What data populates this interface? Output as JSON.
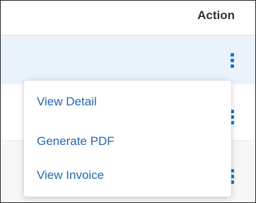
{
  "table": {
    "header": {
      "action_label": "Action"
    },
    "rows": [
      {
        "action_icon": "kebab-menu-icon"
      },
      {
        "action_icon": "kebab-menu-icon"
      },
      {
        "action_icon": "kebab-menu-icon"
      }
    ]
  },
  "context_menu": {
    "items": [
      {
        "label": "View Detail"
      },
      {
        "label": "Generate PDF"
      },
      {
        "label": "View Invoice"
      }
    ]
  },
  "colors": {
    "accent": "#1877d2",
    "menu_link": "#2468b0",
    "selected_row": "#eaf2fb",
    "border": "#2b2b2b"
  }
}
